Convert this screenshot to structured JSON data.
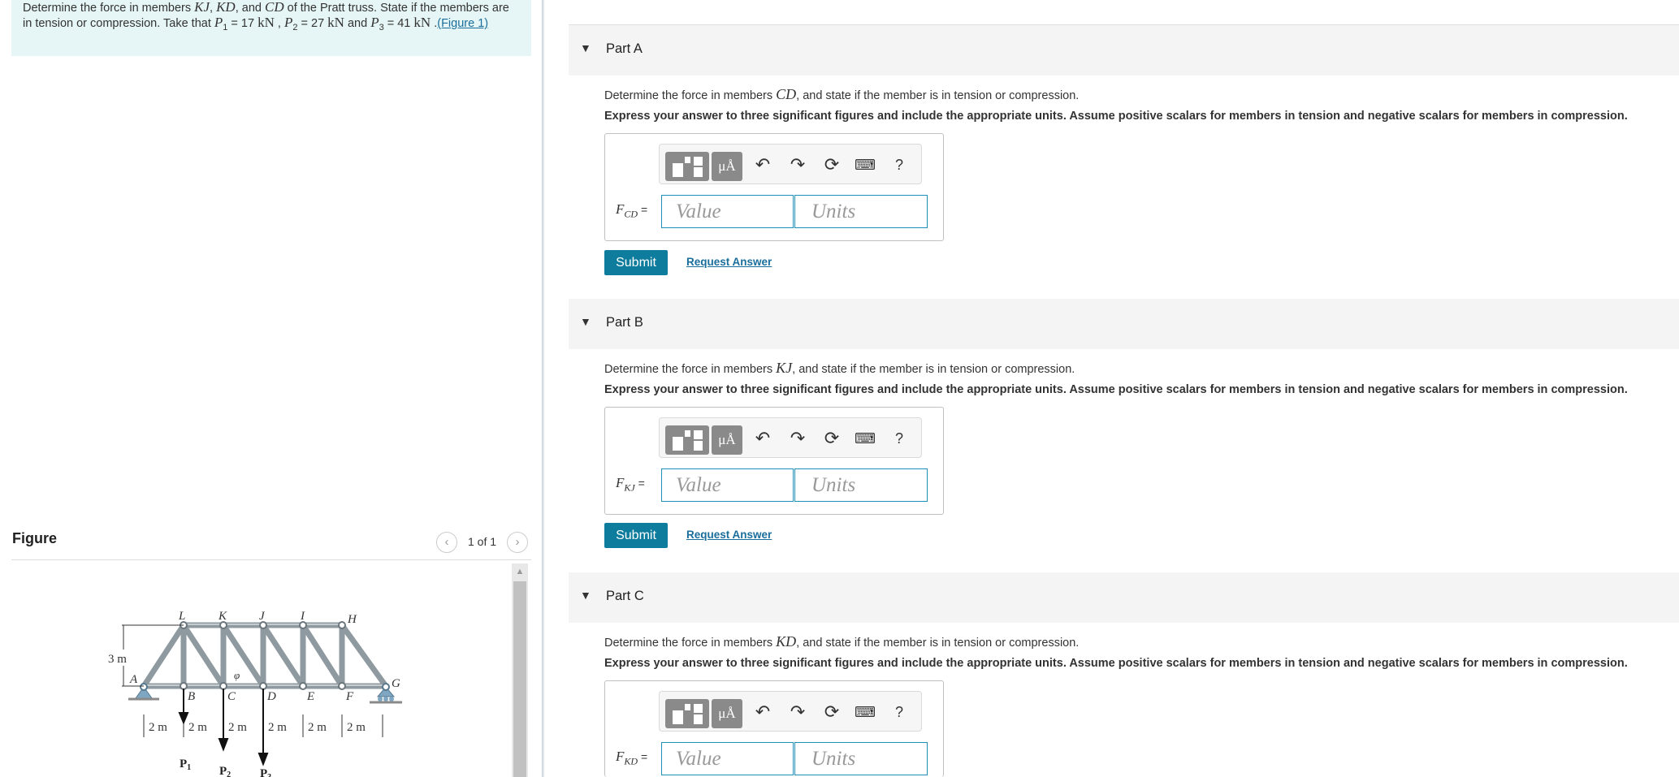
{
  "problem": {
    "t1": "Determine the force in members ",
    "m1": "KJ",
    "t2": ", ",
    "m2": "KD",
    "t3": ", and ",
    "m3": "CD",
    "t4": " of the Pratt truss. State if the members are in tension or compression. Take that ",
    "p1": "P",
    "p1sub": "1",
    "p1val": " = 17 ",
    "p1unit": "kN",
    "t5": " , ",
    "p2": "P",
    "p2sub": "2",
    "p2val": " = 27 ",
    "p2unit": "kN",
    "t6": " and ",
    "p3": "P",
    "p3sub": "3",
    "p3val": " = 41 ",
    "p3unit": "kN",
    "t7": " .",
    "figure_link": "(Figure 1)"
  },
  "figure": {
    "title": "Figure",
    "pager": "1 of 1",
    "prev_icon": "chevron-left-icon",
    "next_icon": "chevron-right-icon",
    "truss": {
      "top_labels": [
        "L",
        "K",
        "J",
        "I",
        "H"
      ],
      "bottom_labels": [
        "A",
        "B",
        "C",
        "D",
        "E",
        "F",
        "G"
      ],
      "height_label": "3 m",
      "dims": [
        "2 m",
        "2 m",
        "2 m",
        "2 m",
        "2 m",
        "2 m"
      ],
      "angle_label": "φ",
      "loads": [
        "P",
        "P",
        "P"
      ],
      "load_subs": [
        "1",
        "2",
        "3"
      ]
    }
  },
  "parts": [
    {
      "title": "Part A",
      "prompt_before": "Determine the force in members ",
      "member": "CD",
      "prompt_after": ", and state if the member is in tension or compression.",
      "instruction": "Express your answer to three significant figures and include the appropriate units. Assume positive scalars for members in tension and negative scalars for members in compression.",
      "var_main": "F",
      "var_sub": "CD",
      "eq": " =",
      "value_placeholder": "Value",
      "units_placeholder": "Units",
      "submit": "Submit",
      "request": "Request Answer"
    },
    {
      "title": "Part B",
      "prompt_before": "Determine the force in members ",
      "member": "KJ",
      "prompt_after": ", and state if the member is in tension or compression.",
      "instruction": "Express your answer to three significant figures and include the appropriate units. Assume positive scalars for members in tension and negative scalars for members in compression.",
      "var_main": "F",
      "var_sub": "KJ",
      "eq": " =",
      "value_placeholder": "Value",
      "units_placeholder": "Units",
      "submit": "Submit",
      "request": "Request Answer"
    },
    {
      "title": "Part C",
      "prompt_before": "Determine the force in members ",
      "member": "KD",
      "prompt_after": ", and state if the member is in tension or compression.",
      "instruction": "Express your answer to three significant figures and include the appropriate units. Assume positive scalars for members in tension and negative scalars for members in compression.",
      "var_main": "F",
      "var_sub": "KD",
      "eq": " =",
      "value_placeholder": "Value",
      "units_placeholder": "Units"
    }
  ],
  "toolbar": {
    "mu_label": "μÅ",
    "help_label": "?",
    "icons": [
      "templates-icon",
      "units-icon",
      "undo-icon",
      "redo-icon",
      "reset-icon",
      "keyboard-icon",
      "help-icon"
    ]
  },
  "colors": {
    "problem_bg": "#e6f5f5",
    "part_header_bg": "#f4f4f4",
    "submit_bg": "#0e7c9c",
    "link": "#1a6e9c",
    "input_border": "#1f8fb8"
  }
}
